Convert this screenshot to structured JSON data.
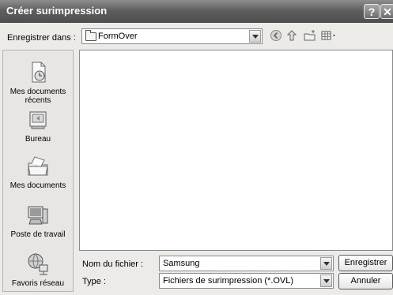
{
  "window": {
    "title": "Créer surimpression",
    "help_label": "?",
    "close_label": "✕"
  },
  "toolbar": {
    "save_in_label": "Enregistrer dans :",
    "save_in_value": "FormOver",
    "icons": [
      "back-icon",
      "up-folder-icon",
      "new-folder-icon",
      "views-menu-icon"
    ]
  },
  "places": [
    {
      "label": "Mes documents récents",
      "icon": "recent-documents-icon"
    },
    {
      "label": "Bureau",
      "icon": "desktop-icon"
    },
    {
      "label": "Mes documents",
      "icon": "my-documents-icon"
    },
    {
      "label": "Poste de travail",
      "icon": "my-computer-icon"
    },
    {
      "label": "Favoris réseau",
      "icon": "network-places-icon"
    }
  ],
  "form": {
    "filename_label": "Nom du fichier :",
    "filename_value": "Samsung",
    "type_label": "Type :",
    "type_value": "Fichiers de surimpression (*.OVL)",
    "save_button": "Enregistrer",
    "cancel_button": "Annuler"
  }
}
